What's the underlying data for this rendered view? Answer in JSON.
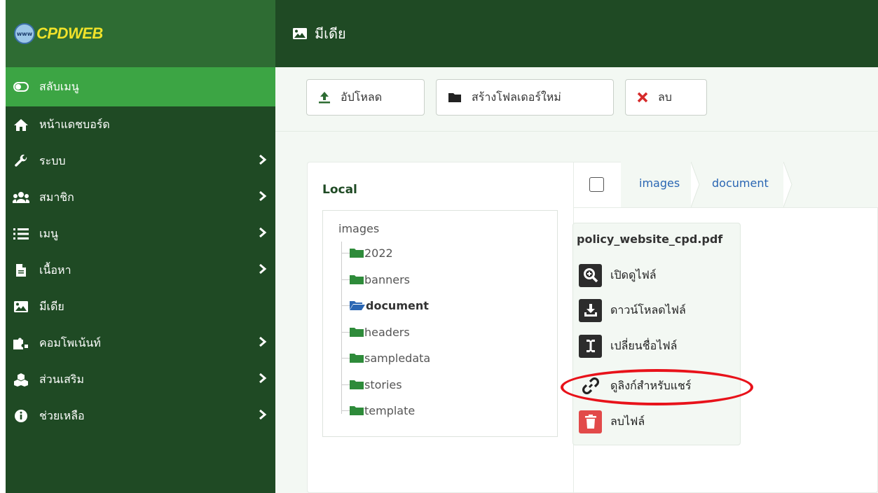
{
  "brand": {
    "logo_text": "www",
    "name": "CPDWEB"
  },
  "sidebar": {
    "items": [
      {
        "label": "สลับเมนู",
        "icon": "toggle-icon",
        "has_submenu": false
      },
      {
        "label": "หน้าแดชบอร์ด",
        "icon": "home-icon",
        "has_submenu": false
      },
      {
        "label": "ระบบ",
        "icon": "wrench-icon",
        "has_submenu": true
      },
      {
        "label": "สมาชิก",
        "icon": "users-icon",
        "has_submenu": true
      },
      {
        "label": "เมนู",
        "icon": "list-icon",
        "has_submenu": true
      },
      {
        "label": "เนื้อหา",
        "icon": "file-icon",
        "has_submenu": true
      },
      {
        "label": "มีเดีย",
        "icon": "image-icon",
        "has_submenu": false
      },
      {
        "label": "คอมโพเน้นท์",
        "icon": "puzzle-icon",
        "has_submenu": true
      },
      {
        "label": "ส่วนเสริม",
        "icon": "cubes-icon",
        "has_submenu": true
      },
      {
        "label": "ช่วยเหลือ",
        "icon": "info-icon",
        "has_submenu": true
      }
    ]
  },
  "header": {
    "title": "มีเดีย",
    "icon": "image-icon"
  },
  "toolbar": {
    "upload_label": "อัปโหลด",
    "new_folder_label": "สร้างโฟลเดอร์ใหม่",
    "delete_label": "ลบ"
  },
  "tree": {
    "title": "Local",
    "root": "images",
    "folders": [
      "2022",
      "banners",
      "document",
      "headers",
      "sampledata",
      "stories",
      "template"
    ],
    "active": "document"
  },
  "breadcrumb": [
    "images",
    "document"
  ],
  "file_menu": {
    "filename": "policy_website_cpd.pdf",
    "items": [
      {
        "label": "เปิดดูไฟล์",
        "icon": "zoom-icon"
      },
      {
        "label": "ดาวน์โหลดไฟล์",
        "icon": "download-icon"
      },
      {
        "label": "เปลี่ยนชื่อไฟล์",
        "icon": "text-cursor-icon"
      },
      {
        "label": "ดูลิงก์สำหรับแชร์",
        "icon": "link-icon"
      },
      {
        "label": "ลบไฟล์",
        "icon": "trash-icon"
      }
    ],
    "highlighted_item": "ดูลิงก์สำหรับแชร์"
  },
  "colors": {
    "sidebar": "#1f4a24",
    "brand_bg": "#2e6c33",
    "toggle_bg": "#3ca544",
    "folder": "#2e8b3a",
    "link": "#2a66b3",
    "highlight": "#e8121a"
  }
}
